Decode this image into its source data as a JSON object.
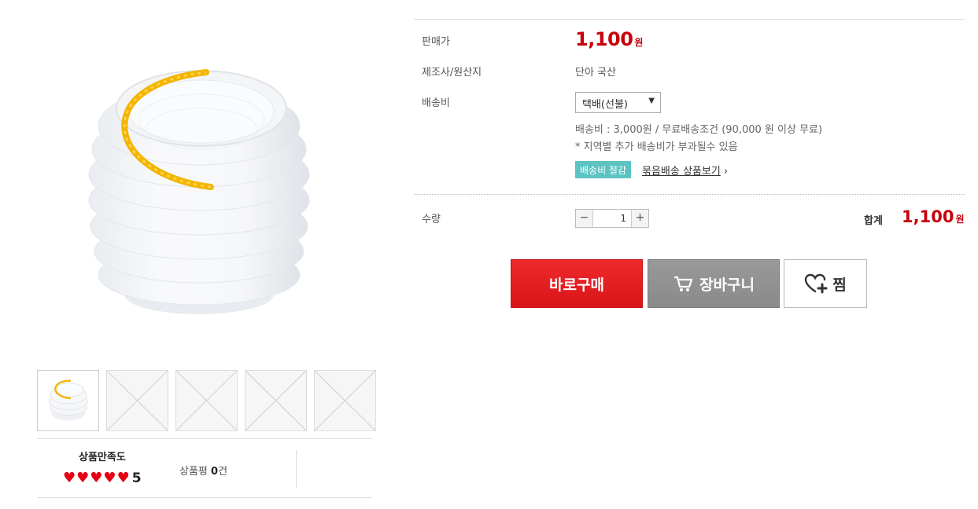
{
  "gallery": {
    "main_image": "white-accordion-bowl-with-yellow-handle",
    "thumbnails": [
      {
        "kind": "product-photo",
        "active": true
      },
      {
        "kind": "placeholder",
        "active": false
      },
      {
        "kind": "placeholder",
        "active": false
      },
      {
        "kind": "placeholder",
        "active": false
      },
      {
        "kind": "placeholder",
        "active": false
      }
    ]
  },
  "rating": {
    "title": "상품만족도",
    "hearts": [
      "♥",
      "♥",
      "♥",
      "♥",
      "♥"
    ],
    "score": "5",
    "review_label_prefix": "상품평 ",
    "review_count": "0",
    "review_label_suffix": "건"
  },
  "info": {
    "price_label": "판매가",
    "price": "1,100",
    "currency": "원",
    "maker_label": "제조사/원산지",
    "maker_value": "단아 국산",
    "shipping_label": "배송비",
    "shipping_select": "택배(선불)",
    "shipping_desc_1": "배송비 : 3,000원 / 무료배송조건 (90,000 원 이상 무료)",
    "shipping_desc_2": "* 지역별 추가 배송비가 부과될수 있음",
    "ship_badge": "배송비 절감",
    "bundle_link": "묶음배송 상품보기",
    "qty_label": "수량",
    "qty_minus": "−",
    "qty_value": "1",
    "qty_plus": "+",
    "total_label": "합계",
    "total_price": "1,100",
    "total_currency": "원"
  },
  "actions": {
    "buy_now": "바로구매",
    "cart": "장바구니",
    "wish": "찜"
  },
  "colors": {
    "accent_red": "#c8000b",
    "buy_button": "#e31b20",
    "cart_button": "#919191",
    "badge_teal": "#5bc3c1"
  },
  "icons": {
    "select_arrow": "▼",
    "chevron": "›",
    "cart": "cart-icon",
    "wish": "heart-plus-icon"
  }
}
